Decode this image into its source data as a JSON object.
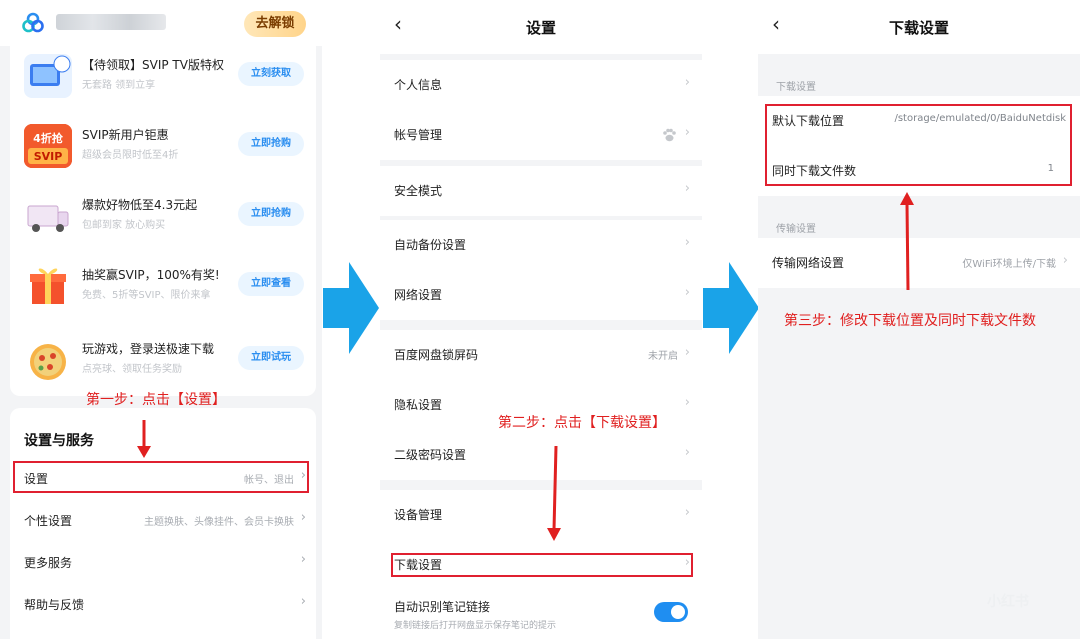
{
  "panel1": {
    "unlock_label": "去解锁",
    "promos": [
      {
        "title": "【待领取】SVIP TV版特权",
        "sub": "无套路 领到立享",
        "action": "立刻获取",
        "thumb": "tv-thumb"
      },
      {
        "title": "SVIP新用户钜惠",
        "sub": "超级会员限时低至4折",
        "action": "立即抢购",
        "thumb_text": "4折抢\nSVIP"
      },
      {
        "title": "爆款好物低至4.3元起",
        "sub": "包邮到家 放心购买",
        "action": "立即抢购",
        "thumb": "van-thumb"
      },
      {
        "title": "抽奖赢SVIP，100%有奖!",
        "sub": "免费、5折等SVIP、限价来拿",
        "action": "立即查看",
        "thumb": "gift-thumb"
      },
      {
        "title": "玩游戏，登录送极速下载",
        "sub": "点亮球、领取任务奖励",
        "action": "立即试玩",
        "thumb": "pizza-thumb"
      }
    ],
    "step1": "第一步：点击【设置】",
    "services_title": "设置与服务",
    "service_rows": [
      {
        "label": "设置",
        "value": "帐号、退出"
      },
      {
        "label": "个性设置",
        "value": "主题换肤、头像挂件、会员卡换肤"
      },
      {
        "label": "更多服务",
        "value": ""
      },
      {
        "label": "帮助与反馈",
        "value": ""
      }
    ]
  },
  "panel2": {
    "title": "设置",
    "rows": [
      {
        "label": "个人信息",
        "value": ""
      },
      {
        "label": "帐号管理",
        "value": ""
      },
      {
        "label": "安全模式",
        "value": ""
      },
      {
        "label": "自动备份设置",
        "value": ""
      },
      {
        "label": "网络设置",
        "value": ""
      },
      {
        "label": "百度网盘锁屏码",
        "value": "未开启"
      },
      {
        "label": "隐私设置",
        "value": ""
      },
      {
        "label": "二级密码设置",
        "value": ""
      },
      {
        "label": "设备管理",
        "value": ""
      },
      {
        "label": "下载设置",
        "value": ""
      },
      {
        "label": "自动识别笔记链接",
        "value": "",
        "sub": "复制链接后打开网盘显示保存笔记的提示"
      }
    ],
    "step2": "第二步：点击【下载设置】"
  },
  "panel3": {
    "title": "下载设置",
    "section_download": "下载设置",
    "default_location_label": "默认下载位置",
    "default_location_value": "/storage/emulated/0/BaiduNetdisk",
    "concurrent_label": "同时下载文件数",
    "concurrent_value": "1",
    "section_transfer": "传输设置",
    "network_label": "传输网络设置",
    "network_value": "仅WiFi环境上传/下载",
    "step3": "第三步：修改下载位置及同时下载文件数"
  },
  "colors": {
    "accent": "#1f8ef1",
    "annotation": "#e02020",
    "flow_arrow": "#1aa3e8"
  }
}
